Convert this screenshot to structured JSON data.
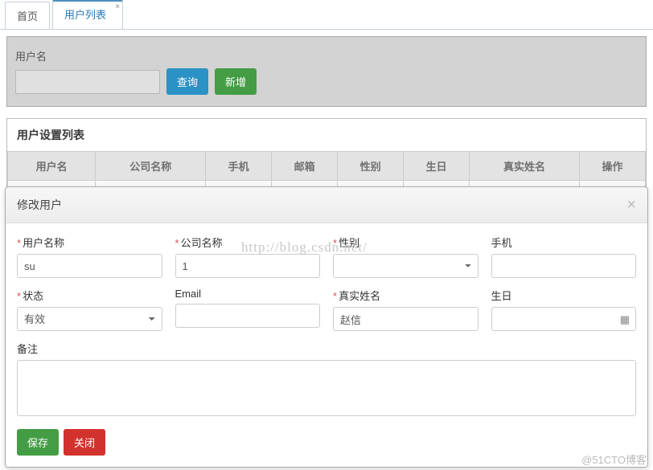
{
  "tabs": {
    "home": "首页",
    "user_list": "用户列表"
  },
  "filter": {
    "username_label": "用户名",
    "query_btn": "查询",
    "add_btn": "新增"
  },
  "list": {
    "title": "用户设置列表",
    "headers": [
      "用户名",
      "公司名称",
      "手机",
      "邮箱",
      "性别",
      "生日",
      "真实姓名",
      "操作"
    ]
  },
  "modal": {
    "title": "修改用户",
    "fields": {
      "username": {
        "label": "用户名称",
        "required": true,
        "value": "su"
      },
      "company": {
        "label": "公司名称",
        "required": true,
        "value": "1"
      },
      "gender": {
        "label": "性别",
        "required": true,
        "value": ""
      },
      "phone": {
        "label": "手机",
        "required": false,
        "value": ""
      },
      "status": {
        "label": "状态",
        "required": true,
        "value": "有效"
      },
      "email": {
        "label": "Email",
        "required": false,
        "value": ""
      },
      "realname": {
        "label": "真实姓名",
        "required": true,
        "value": "赵信"
      },
      "birthday": {
        "label": "生日",
        "required": false,
        "value": ""
      },
      "remark": {
        "label": "备注",
        "required": false,
        "value": ""
      }
    },
    "buttons": {
      "save": "保存",
      "close": "关闭"
    }
  },
  "watermark": "http://blog.csdn.net/",
  "footer": "@51CTO博客"
}
